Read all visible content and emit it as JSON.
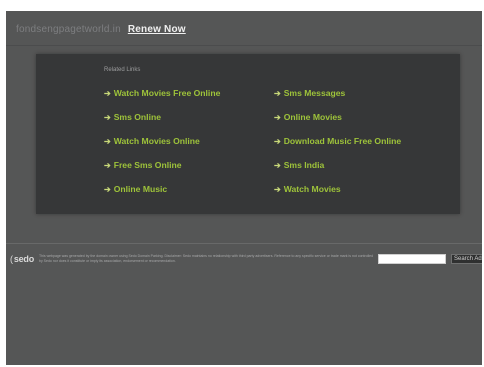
{
  "header": {
    "domain": "fondsengpagetworld.in",
    "renew_label": "Renew Now"
  },
  "panel": {
    "title": "Related Links",
    "arrow": "➔",
    "links": [
      {
        "label": "Watch Movies Free Online"
      },
      {
        "label": "Sms Messages"
      },
      {
        "label": "Sms Online"
      },
      {
        "label": "Online Movies"
      },
      {
        "label": "Watch Movies Online"
      },
      {
        "label": "Download Music Free Online"
      },
      {
        "label": "Free Sms Online"
      },
      {
        "label": "Sms India"
      },
      {
        "label": "Online Music"
      },
      {
        "label": "Watch Movies"
      }
    ]
  },
  "footer": {
    "logo": "sedo",
    "disclaimer": "This webpage was generated by the domain owner using Sedo Domain Parking. Disclaimer: Sedo maintains no relationship with third party advertisers. Reference to any specific service or trade mark is not controlled by Sedo nor does it constitute or imply its association, endorsement or recommendation.",
    "search_value": "",
    "search_button": "Search Ads"
  }
}
